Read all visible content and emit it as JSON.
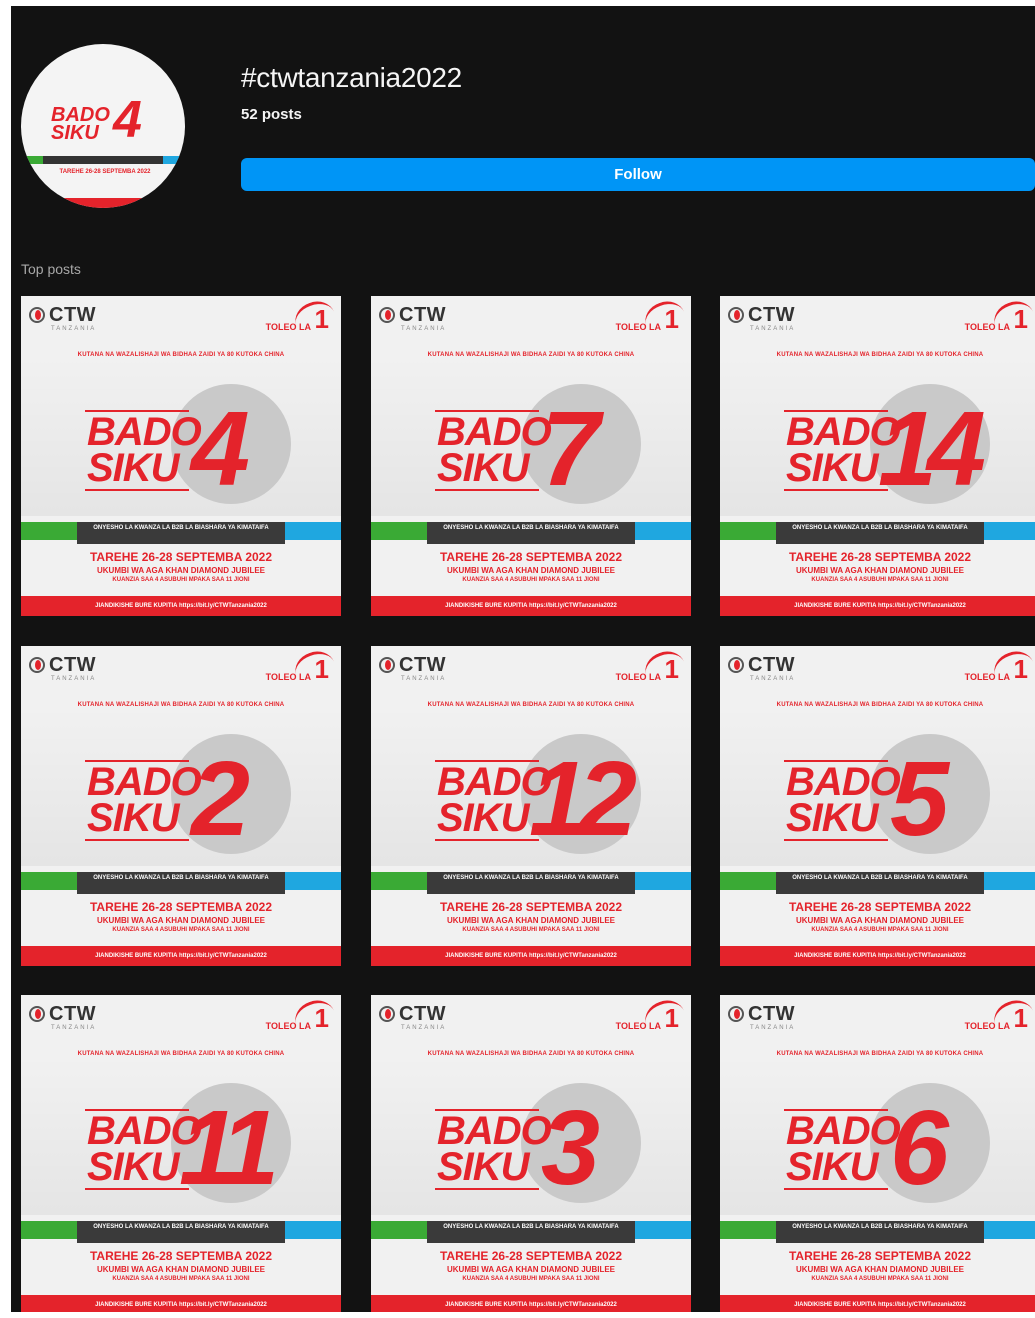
{
  "header": {
    "hashtag": "#ctwtanzania2022",
    "post_count": "52 posts",
    "follow_label": "Follow"
  },
  "avatar": {
    "bado": "BADO",
    "siku": "SIKU",
    "number": "4",
    "date": "TAREHE 26-28 SEPTEMBA 2022"
  },
  "section_label": "Top posts",
  "poster_common": {
    "brand": "CTW",
    "brand_sub": "TANZANIA",
    "toleo": "TOLEO LA",
    "toleo_num": "1",
    "subtitle": "KUTANA NA WAZALISHAJI WA BIDHAA ZAIDI YA 80 KUTOKA CHINA",
    "bado": "BADO",
    "siku": "SIKU",
    "banner": "ONYESHO LA KWANZA LA B2B LA BIASHARA YA KIMATAIFA",
    "tarehe": "TAREHE 26-28 SEPTEMBA 2022",
    "ukumbi": "UKUMBI WA AGA KHAN DIAMOND JUBILEE",
    "muda": "KUANZIA SAA 4 ASUBUHI MPAKA SAA 11 JIONI",
    "footer": "JIANDIKISHE BURE KUPITIA https://bit.ly/CTWTanzania2022"
  },
  "posts": [
    {
      "number": "4"
    },
    {
      "number": "7"
    },
    {
      "number": "14"
    },
    {
      "number": "2"
    },
    {
      "number": "12"
    },
    {
      "number": "5"
    },
    {
      "number": "11"
    },
    {
      "number": "3"
    },
    {
      "number": "6"
    }
  ],
  "colors": {
    "background": "#121212",
    "follow_button": "#0095f6",
    "poster_red": "#e4232b",
    "poster_green": "#3aaa35",
    "poster_blue": "#1fa7e0"
  }
}
